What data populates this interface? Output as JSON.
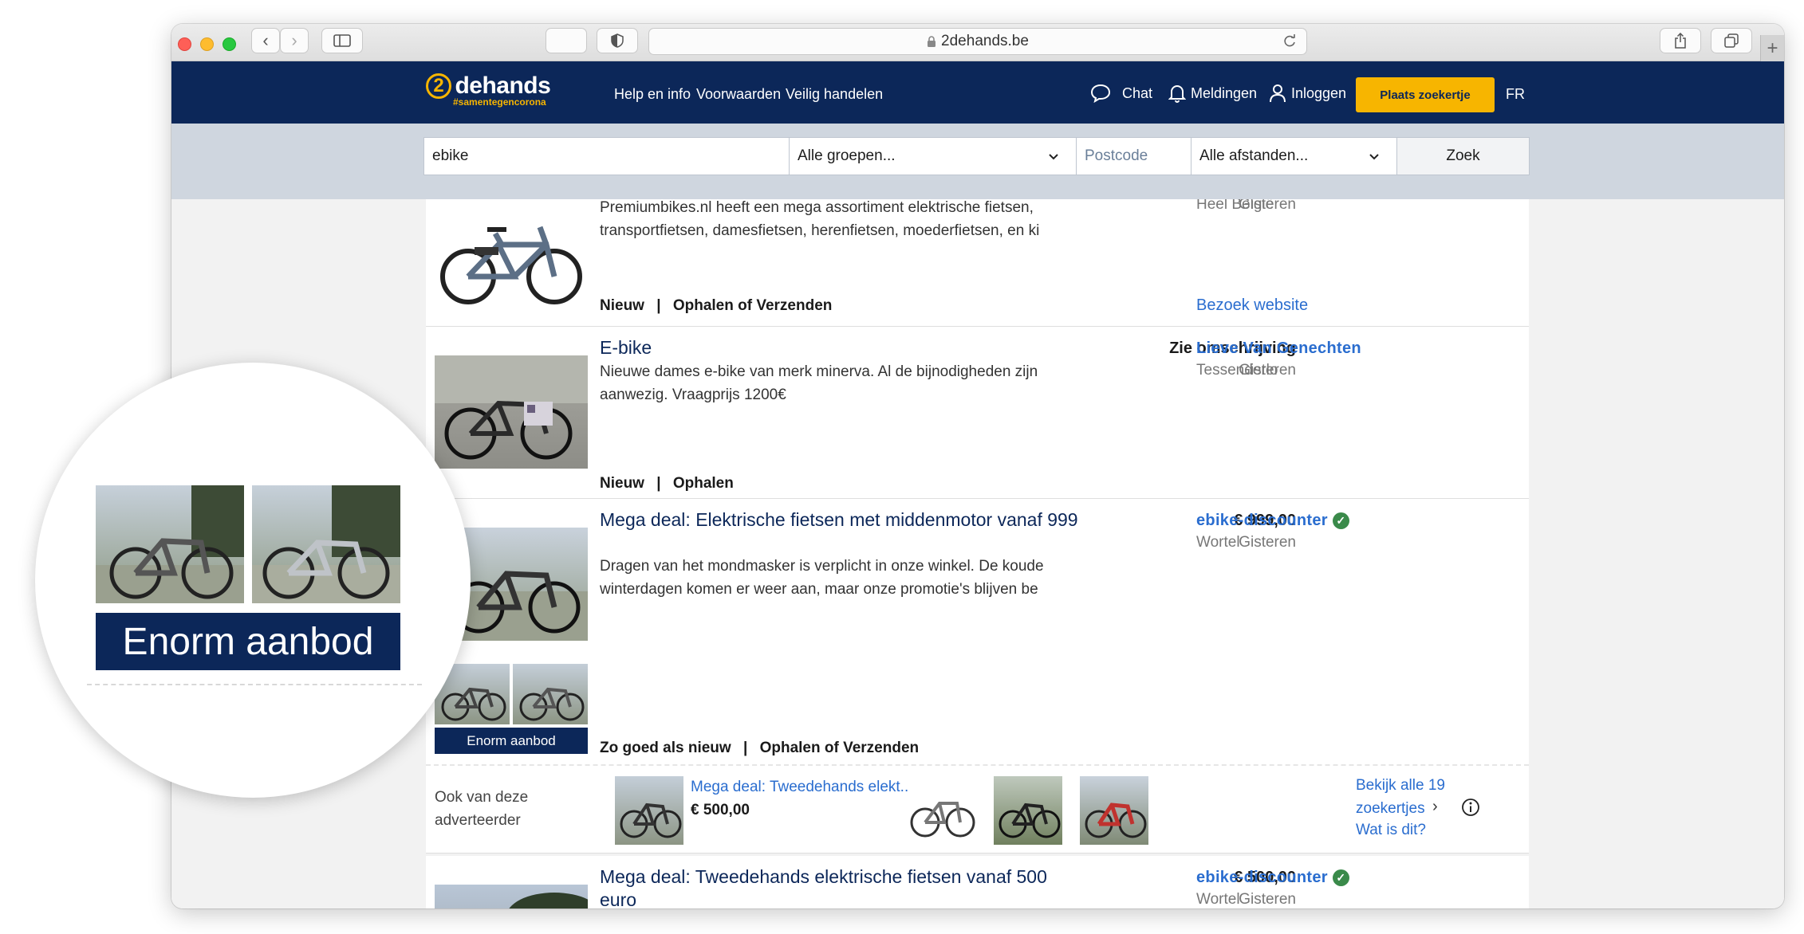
{
  "browser": {
    "url": "2dehands.be"
  },
  "header": {
    "logo_text": "dehands",
    "logo_number": "2",
    "logo_tagline": "#samentegencorona",
    "nav": [
      "Help en info",
      "Voorwaarden",
      "Veilig handelen"
    ],
    "chat_label": "Chat",
    "notifications_label": "Meldingen",
    "login_label": "Inloggen",
    "post_ad_label": "Plaats zoekertje",
    "language_label": "FR"
  },
  "search": {
    "query": "ebike",
    "category_value": "Alle groepen...",
    "postcode_placeholder": "Postcode",
    "distance_value": "Alle afstanden...",
    "submit_label": "Zoek"
  },
  "listings": [
    {
      "desc_partial_top": "Premiumbikes.nl heeft een mega assortiment elektrische fietsen,",
      "desc": "transportfietsen, damesfietsen, herenfietsen, moederfietsen, en ki",
      "condition": "Nieuw",
      "delivery": "Ophalen of Verzenden",
      "date_partial": "Gisteren",
      "location_partial": "Heel België",
      "website_link": "Bezoek website"
    },
    {
      "title": "E-bike",
      "desc": "Nieuwe dames e-bike van merk minerva.  Al de bijnodigheden zijn aanwezig. Vraagprijs 1200€",
      "condition": "Nieuw",
      "delivery": "Ophalen",
      "price": "Zie omschrijving",
      "date": "Gisteren",
      "seller": "Lieve Van Genechten",
      "location": "Tessenderlo"
    },
    {
      "title": "Mega deal: Elektrische fietsen met middenmotor vanaf 999",
      "desc": "Dragen van het mondmasker is verplicht in onze winkel. De koude winterdagen komen er weer aan, maar onze promotie's blijven be",
      "condition": "Zo goed als nieuw",
      "delivery": "Ophalen of Verzenden",
      "price": "€ 999,00",
      "date": "Gisteren",
      "seller": "ebike-discounter",
      "location": "Wortel",
      "badge": "Enorm aanbod"
    },
    {
      "title": "Mega deal: Tweedehands elektrische fietsen vanaf 500 euro",
      "price": "€ 500,00",
      "date": "Gisteren",
      "seller": "ebike-discounter",
      "location": "Wortel"
    }
  ],
  "advertiser_strip": {
    "label": "Ook van deze adverteerder",
    "item_title": "Mega deal: Tweedehands elekt...",
    "item_price": "€ 500,00",
    "view_all": "Bekijk alle 19 zoekertjes",
    "what_is_this": "Wat is dit?"
  },
  "magnifier": {
    "badge": "Enorm aanbod"
  },
  "colors": {
    "brand_navy": "#0c2759",
    "brand_yellow": "#f7b500",
    "link_blue": "#2a6dcf",
    "verified_green": "#3a8a4a"
  }
}
